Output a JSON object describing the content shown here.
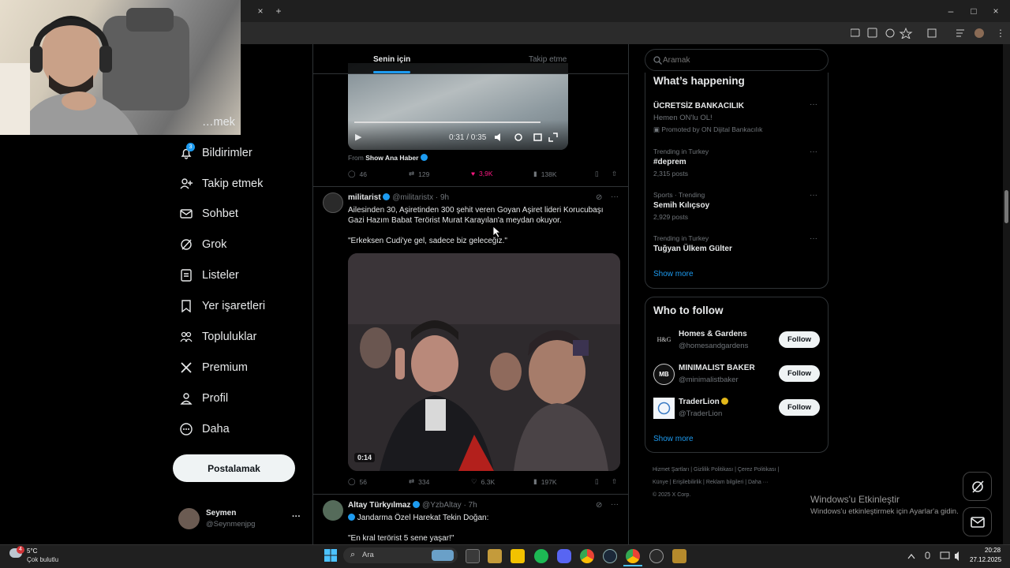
{
  "browser": {
    "tab_close": "×",
    "new_tab": "+",
    "window_controls": [
      "–",
      "□",
      "×"
    ]
  },
  "left_nav": {
    "items": [
      {
        "label": "…mek",
        "icon": "explore-icon"
      },
      {
        "label": "Bildirimler",
        "icon": "bell-icon",
        "badge": "3"
      },
      {
        "label": "Takip etmek",
        "icon": "person-add-icon"
      },
      {
        "label": "Sohbet",
        "icon": "mail-icon"
      },
      {
        "label": "Grok",
        "icon": "grok-icon"
      },
      {
        "label": "Listeler",
        "icon": "list-icon"
      },
      {
        "label": "Yer işaretleri",
        "icon": "bookmark-icon"
      },
      {
        "label": "Topluluklar",
        "icon": "people-icon"
      },
      {
        "label": "Premium",
        "icon": "x-logo-icon"
      },
      {
        "label": "Profil",
        "icon": "person-icon"
      },
      {
        "label": "Daha",
        "icon": "more-circle-icon"
      }
    ],
    "post_button": "Postalamak",
    "account": {
      "name": "Seymen",
      "handle": "@Seynmenjpg",
      "more": "···"
    }
  },
  "tabs": {
    "for_you": "Senin için",
    "following": "Takip etme"
  },
  "tweet1": {
    "video_time": "0:31 / 0:35",
    "from_label": "From",
    "from_source": "Show Ana Haber",
    "replies": "46",
    "reposts": "129",
    "likes": "3,9K",
    "views": "138K"
  },
  "tweet2": {
    "name": "militarist",
    "handle": "@militaristx",
    "time": "· 9h",
    "text1": "Ailesinden 30, Aşiretinden 300 şehit veren Goyan Aşiret lideri Korucubaşı Gazi Hazım Babat Terörist Murat Karayılan'a meydan okuyor.",
    "text2": "\"Erkeksen Cudi'ye gel, sadece biz geleceğiz.\"",
    "video_time": "0:14",
    "replies": "56",
    "reposts": "334",
    "likes": "6.3K",
    "views": "197K"
  },
  "tweet3": {
    "name": "Altay Türkyılmaz",
    "handle": "@YzbAltay",
    "time": "· 7h",
    "text1": "Jandarma Özel Harekat Tekin Doğan:",
    "text2": "\"En kral terörist 5 sene yaşar!\""
  },
  "search": {
    "placeholder": "Aramak"
  },
  "happening": {
    "title": "What’s happening",
    "items": [
      {
        "meta": "",
        "title": "ÜCRETSİZ BANKACILIK",
        "sub": "Hemen ON'lu OL!",
        "promo": "Promoted by ON Dijital Bankacılık"
      },
      {
        "meta": "Trending in Turkey",
        "title": "#deprem",
        "sub": "2,315 posts"
      },
      {
        "meta": "Sports · Trending",
        "title": "Semih Kılıçsoy",
        "sub": "2,929 posts"
      },
      {
        "meta": "Trending in Turkey",
        "title": "Tuğyan Ülkem Gülter",
        "sub": ""
      }
    ],
    "show_more": "Show more"
  },
  "who_to_follow": {
    "title": "Who to follow",
    "accounts": [
      {
        "name": "Homes & Gardens",
        "handle": "@homesandgardens",
        "avatar": "H&G"
      },
      {
        "name": "MINIMALIST BAKER",
        "handle": "@minimalistbaker",
        "avatar": "MB"
      },
      {
        "name": "TraderLion",
        "handle": "@TraderLion",
        "avatar": ""
      }
    ],
    "follow_label": "Follow",
    "show_more": "Show more"
  },
  "footer": {
    "line1": "Hizmet Şartları  |  Gizlilik Politikası  |  Çerez Politikası  |",
    "line2": "Künye  |  Erişilebilirlik  |  Reklam bilgileri  |  Daha ···",
    "line3": "© 2025 X Corp."
  },
  "watermark": {
    "title": "Windows'u Etkinleştir",
    "sub": "Windows'u etkinleştirmek için Ayarlar'a gidin."
  },
  "taskbar": {
    "weather_temp": "5°C",
    "weather_desc": "Çok bulutlu",
    "weather_badge": "4",
    "search": "Ara",
    "time": "20:28",
    "date": "27.12.2025"
  },
  "colors": {
    "accent": "#1d9bf0",
    "like": "#f91880",
    "verified": "#1d9bf0",
    "gold": "#e2b719"
  }
}
